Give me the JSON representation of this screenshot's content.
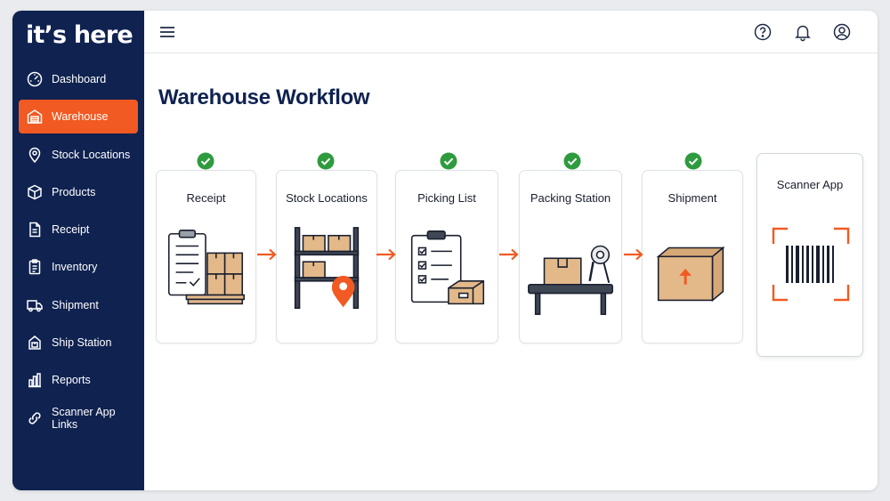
{
  "app": {
    "brand": "it’s here"
  },
  "sidebar": {
    "items": [
      {
        "label": "Dashboard",
        "icon": "dashboard-gauge-icon",
        "active": false
      },
      {
        "label": "Warehouse",
        "icon": "warehouse-icon",
        "active": true
      },
      {
        "label": "Stock Locations",
        "icon": "location-pin-icon",
        "active": false
      },
      {
        "label": "Products",
        "icon": "cube-icon",
        "active": false
      },
      {
        "label": "Receipt",
        "icon": "document-icon",
        "active": false
      },
      {
        "label": "Inventory",
        "icon": "clipboard-list-icon",
        "active": false
      },
      {
        "label": "Shipment",
        "icon": "truck-icon",
        "active": false
      },
      {
        "label": "Ship Station",
        "icon": "ship-station-icon",
        "active": false
      },
      {
        "label": "Reports",
        "icon": "bar-chart-icon",
        "active": false
      },
      {
        "label": "Scanner App Links",
        "icon": "link-icon",
        "active": false
      }
    ]
  },
  "topbar": {
    "icons": [
      "menu-icon",
      "help-icon",
      "bell-icon",
      "user-avatar-icon"
    ]
  },
  "page": {
    "title": "Warehouse Workflow"
  },
  "workflow": {
    "steps": [
      {
        "label": "Receipt",
        "completed": true,
        "icon": "clipboard-pallet-illustration"
      },
      {
        "label": "Stock Locations",
        "completed": true,
        "icon": "shelving-location-illustration"
      },
      {
        "label": "Picking List",
        "completed": true,
        "icon": "checklist-box-illustration"
      },
      {
        "label": "Packing Station",
        "completed": true,
        "icon": "packing-table-illustration"
      },
      {
        "label": "Shipment",
        "completed": true,
        "icon": "shipping-box-illustration"
      }
    ],
    "scanner": {
      "label": "Scanner App",
      "icon": "barcode-scanner-illustration"
    }
  },
  "colors": {
    "sidebar_bg": "#0f2250",
    "accent": "#f15a22",
    "check": "#2e9b3e",
    "box": "#e3b98a"
  }
}
